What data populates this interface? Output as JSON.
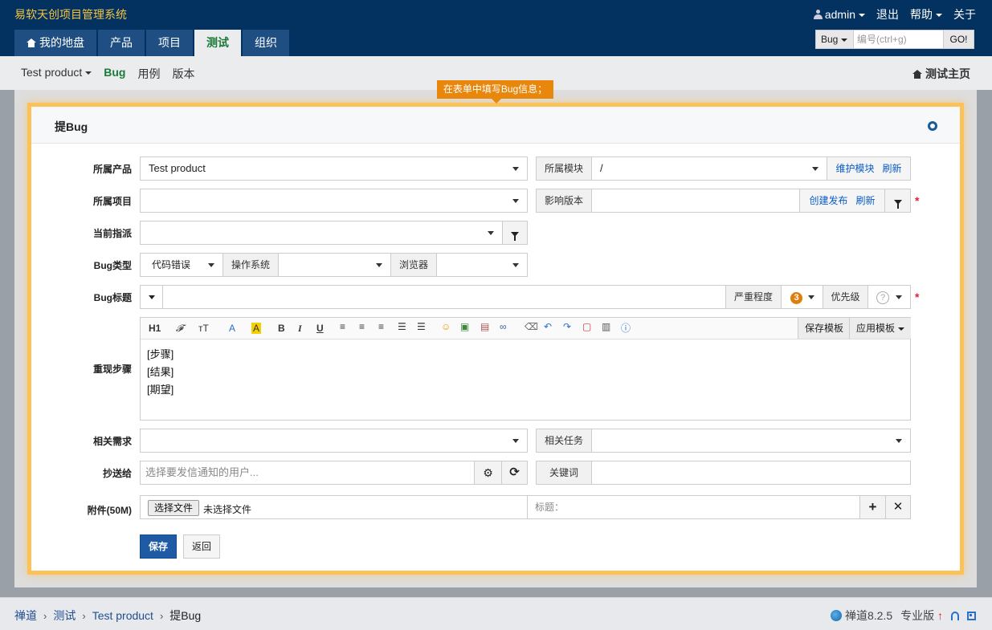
{
  "app": {
    "title": "易软天创项目管理系统"
  },
  "top_links": {
    "user": "admin",
    "logout": "退出",
    "help": "帮助",
    "about": "关于"
  },
  "main_nav": [
    {
      "label": "我的地盘"
    },
    {
      "label": "产品"
    },
    {
      "label": "项目"
    },
    {
      "label": "测试"
    },
    {
      "label": "组织"
    }
  ],
  "search": {
    "type": "Bug",
    "placeholder": "编号(ctrl+g)",
    "go": "GO!"
  },
  "subnav": {
    "product": "Test product",
    "items": [
      "Bug",
      "用例",
      "版本"
    ],
    "right": "测试主页"
  },
  "tip": "在表单中填写Bug信息；",
  "panel": {
    "title": "提Bug"
  },
  "form": {
    "product_label": "所属产品",
    "product_value": "Test product",
    "module_label": "所属模块",
    "module_value": "/",
    "module_link1": "维护模块",
    "module_link2": "刷新",
    "project_label": "所属项目",
    "build_label": "影响版本",
    "build_link1": "创建发布",
    "build_link2": "刷新",
    "assign_label": "当前指派",
    "type_label": "Bug类型",
    "type_value": "代码错误",
    "os_label": "操作系统",
    "browser_label": "浏览器",
    "title_label": "Bug标题",
    "severity_label": "严重程度",
    "severity_value": "3",
    "priority_label": "优先级",
    "priority_value": "?",
    "steps_label": "重现步骤",
    "save_template": "保存模板",
    "apply_template": "应用模板",
    "steps_lines": [
      "[步骤]",
      "[结果]",
      "[期望]"
    ],
    "story_label": "相关需求",
    "task_label": "相关任务",
    "mailto_label": "抄送给",
    "mailto_placeholder": "选择要发信通知的用户...",
    "keywords_label": "关键词",
    "files_label": "附件(50M)",
    "file_button": "选择文件",
    "file_none": "未选择文件",
    "file_title_placeholder": "标题：",
    "save": "保存",
    "back": "返回",
    "required_mark": "*"
  },
  "toolbar_icons": [
    "H1",
    "𝓕",
    "тT",
    "A",
    "A",
    "B",
    "I",
    "U"
  ],
  "footer": {
    "crumbs": [
      "禅道",
      "测试",
      "Test product",
      "提Bug"
    ],
    "version": "禅道8.2.5",
    "edition": "专业版"
  },
  "colors": {
    "header": "#033260",
    "nav_active_text": "#1a7a3a",
    "tip": "#e9870d",
    "panel_border": "#fbc25a",
    "primary": "#1f5aa5"
  }
}
